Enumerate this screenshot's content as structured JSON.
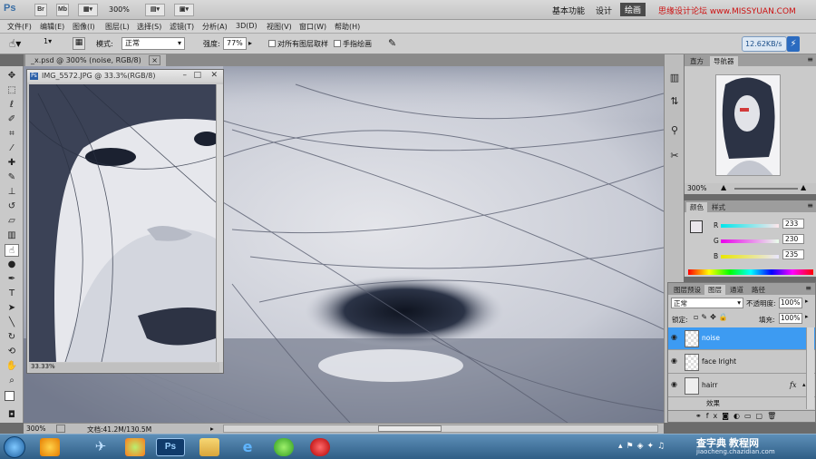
{
  "app": {
    "logo": "Ps",
    "zoom_dropdown": "300%",
    "workspaces": [
      "基本功能",
      "设计",
      "绘画"
    ],
    "active_workspace": "绘画",
    "cs_live": "CS Live",
    "watermark_top": "思缘设计论坛 www.MISSYUAN.COM"
  },
  "menu": [
    "文件(F)",
    "编辑(E)",
    "图像(I)",
    "图层(L)",
    "选择(S)",
    "滤镜(T)",
    "分析(A)",
    "3D(D)",
    "视图(V)",
    "窗口(W)",
    "帮助(H)"
  ],
  "options": {
    "mode_label": "模式:",
    "mode_value": "正常",
    "strength_label": "强度:",
    "strength_value": "77%",
    "sample_all_label": "对所有图层取样",
    "finger_paint_label": "手指绘画",
    "brush_size": "1",
    "net_speed": "12.62KB/s"
  },
  "document": {
    "tab_title": "_x.psd @ 300% (noise, RGB/8)",
    "zoom": "300%",
    "doc_info": "文档:41.2M/130.5M"
  },
  "float_window": {
    "title": "IMG_5572.JPG @ 33.3%(RGB/8)",
    "zoom": "33.33%"
  },
  "navigator": {
    "tabs": [
      "直方",
      "导航器"
    ],
    "active_tab": "导航器",
    "zoom": "300%"
  },
  "color_panel": {
    "tabs": [
      "颜色",
      "样式"
    ],
    "active_tab": "颜色",
    "r_label": "R",
    "r_value": "233",
    "g_label": "G",
    "g_value": "230",
    "b_label": "B",
    "b_value": "235"
  },
  "layers_panel": {
    "tabs": [
      "图层预设",
      "图层",
      "通道",
      "路径"
    ],
    "active_tab": "图层",
    "blend_mode": "正常",
    "opacity_label": "不透明度:",
    "opacity_value": "100%",
    "lock_label": "锁定:",
    "fill_label": "填充:",
    "fill_value": "100%",
    "layers": [
      {
        "name": "noise",
        "selected": true
      },
      {
        "name": "face lright",
        "selected": false
      },
      {
        "name": "hairr",
        "selected": false,
        "fx": "fx"
      }
    ],
    "effects_label": "效果"
  },
  "taskbar": {
    "watermark": "查字典 教程网",
    "watermark_sub": "jiaocheng.chazidian.com"
  },
  "colors": {
    "selected_layer": "#3d9bf2",
    "taskbar": "#2f5e86"
  }
}
